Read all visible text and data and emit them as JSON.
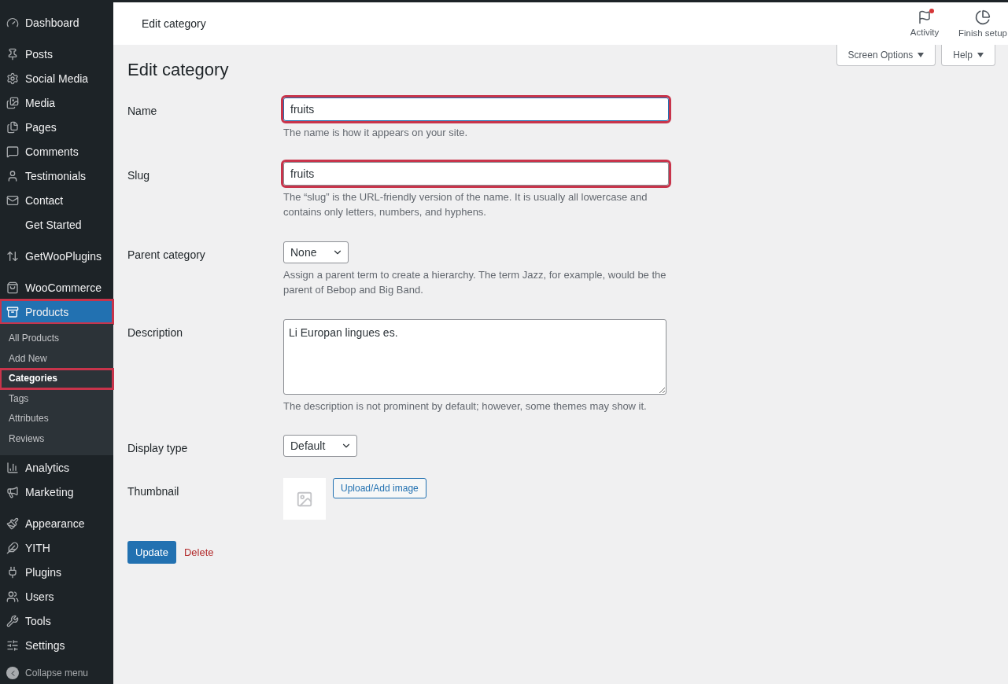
{
  "sidebar": {
    "items": [
      {
        "label": "Dashboard",
        "separated": false,
        "selected": false,
        "highlighted": false
      },
      {
        "label": "Posts",
        "separated": true,
        "selected": false,
        "highlighted": false
      },
      {
        "label": "Social Media",
        "separated": false,
        "selected": false,
        "highlighted": false
      },
      {
        "label": "Media",
        "separated": false,
        "selected": false,
        "highlighted": false
      },
      {
        "label": "Pages",
        "separated": false,
        "selected": false,
        "highlighted": false
      },
      {
        "label": "Comments",
        "separated": false,
        "selected": false,
        "highlighted": false
      },
      {
        "label": "Testimonials",
        "separated": false,
        "selected": false,
        "highlighted": false
      },
      {
        "label": "Contact",
        "separated": false,
        "selected": false,
        "highlighted": false
      },
      {
        "label": "Get Started",
        "separated": false,
        "selected": false,
        "highlighted": false
      },
      {
        "label": "GetWooPlugins",
        "separated": true,
        "selected": false,
        "highlighted": false
      },
      {
        "label": "WooCommerce",
        "separated": true,
        "selected": false,
        "highlighted": false
      },
      {
        "label": "Products",
        "separated": false,
        "selected": true,
        "highlighted": true,
        "children": [
          {
            "label": "All Products",
            "selected": false,
            "highlighted": false
          },
          {
            "label": "Add New",
            "selected": false,
            "highlighted": false
          },
          {
            "label": "Categories",
            "selected": true,
            "highlighted": true
          },
          {
            "label": "Tags",
            "selected": false,
            "highlighted": false
          },
          {
            "label": "Attributes",
            "selected": false,
            "highlighted": false
          },
          {
            "label": "Reviews",
            "selected": false,
            "highlighted": false
          }
        ]
      },
      {
        "label": "Analytics",
        "separated": false,
        "selected": false,
        "highlighted": false
      },
      {
        "label": "Marketing",
        "separated": false,
        "selected": false,
        "highlighted": false
      },
      {
        "label": "Appearance",
        "separated": true,
        "selected": false,
        "highlighted": false
      },
      {
        "label": "YITH",
        "separated": false,
        "selected": false,
        "highlighted": false
      },
      {
        "label": "Plugins",
        "separated": false,
        "selected": false,
        "highlighted": false
      },
      {
        "label": "Users",
        "separated": false,
        "selected": false,
        "highlighted": false
      },
      {
        "label": "Tools",
        "separated": false,
        "selected": false,
        "highlighted": false
      },
      {
        "label": "Settings",
        "separated": false,
        "selected": false,
        "highlighted": false
      }
    ],
    "collapse": "Collapse menu"
  },
  "header": {
    "title": "Edit category",
    "actions": [
      {
        "label": "Activity",
        "badge": true
      },
      {
        "label": "Finish setup",
        "badge": false
      }
    ]
  },
  "screen_tabs": [
    "Screen Options",
    "Help"
  ],
  "page_title": "Edit category",
  "fields": [
    {
      "kind": "text",
      "label": "Name",
      "value": "fruits",
      "help": "The name is how it appears on your site.",
      "highlighted": true,
      "focused": true
    },
    {
      "kind": "text",
      "label": "Slug",
      "value": "fruits",
      "help": "The “slug” is the URL-friendly version of the name. It is usually all lowercase and contains only letters, numbers, and hyphens.",
      "highlighted": true,
      "focused": false
    },
    {
      "kind": "select",
      "label": "Parent category",
      "value": "None",
      "help": "Assign a parent term to create a hierarchy. The term Jazz, for example, would be the parent of Bebop and Big Band."
    },
    {
      "kind": "textarea",
      "label": "Description",
      "value": "Li Europan lingues es.",
      "help": "The description is not prominent by default; however, some themes may show it."
    },
    {
      "kind": "select",
      "label": "Display type",
      "value": "Default"
    },
    {
      "kind": "image",
      "label": "Thumbnail",
      "button": "Upload/Add image"
    }
  ],
  "actions": {
    "update": "Update",
    "delete": "Delete"
  }
}
